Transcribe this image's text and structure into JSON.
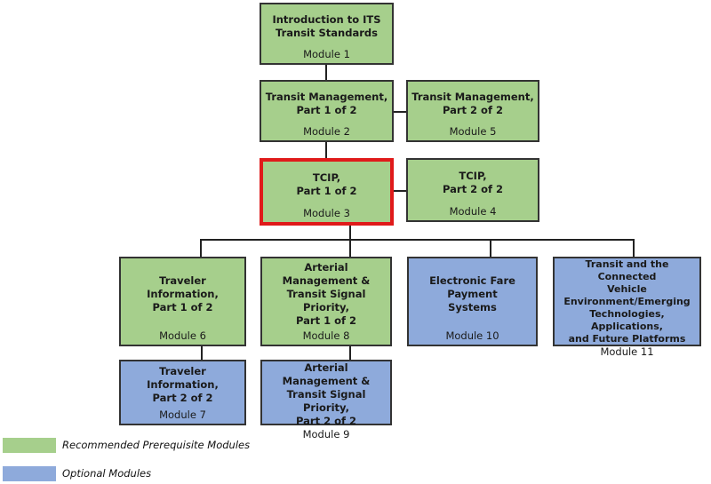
{
  "modules": [
    {
      "id": "m1",
      "title": "Introduction to ITS\nTransit Standards",
      "label": "Module 1",
      "category": "recommended"
    },
    {
      "id": "m2",
      "title": "Transit Management,\nPart 1 of 2",
      "label": "Module 2",
      "category": "recommended"
    },
    {
      "id": "m5",
      "title": "Transit Management,\nPart 2 of 2",
      "label": "Module 5",
      "category": "recommended"
    },
    {
      "id": "m3",
      "title": "TCIP,\nPart 1 of 2",
      "label": "Module 3",
      "category": "recommended",
      "highlighted": true
    },
    {
      "id": "m4",
      "title": "TCIP,\nPart 2 of 2",
      "label": "Module 4",
      "category": "recommended"
    },
    {
      "id": "m6",
      "title": "Traveler Information,\nPart 1 of 2",
      "label": "Module 6",
      "category": "recommended"
    },
    {
      "id": "m8",
      "title": "Arterial Management &\nTransit Signal Priority,\nPart 1 of 2",
      "label": "Module 8",
      "category": "recommended"
    },
    {
      "id": "m10",
      "title": "Electronic Fare Payment\nSystems",
      "label": "Module 10",
      "category": "optional"
    },
    {
      "id": "m11",
      "title": "Transit and the Connected\nVehicle\nEnvironment/Emerging\nTechnologies, Applications,\nand Future Platforms",
      "label": "Module 11",
      "category": "optional"
    },
    {
      "id": "m7",
      "title": "Traveler Information,\nPart 2 of 2",
      "label": "Module 7",
      "category": "optional"
    },
    {
      "id": "m9",
      "title": "Arterial Management &\nTransit Signal Priority,\nPart 2 of 2",
      "label": "Module 9",
      "category": "optional"
    }
  ],
  "connections": [
    [
      "m1",
      "m2"
    ],
    [
      "m2",
      "m5"
    ],
    [
      "m2",
      "m3"
    ],
    [
      "m3",
      "m4"
    ],
    [
      "m3",
      "m6"
    ],
    [
      "m3",
      "m8"
    ],
    [
      "m3",
      "m10"
    ],
    [
      "m3",
      "m11"
    ],
    [
      "m6",
      "m7"
    ],
    [
      "m8",
      "m9"
    ]
  ],
  "legend": [
    {
      "label": "Recommended Prerequisite Modules",
      "color": "#a6cf8c"
    },
    {
      "label": "Optional Modules",
      "color": "#8eaadb"
    }
  ],
  "colors": {
    "recommended": "#a6cf8c",
    "optional": "#8eaadb",
    "highlight": "#e01a1a"
  }
}
